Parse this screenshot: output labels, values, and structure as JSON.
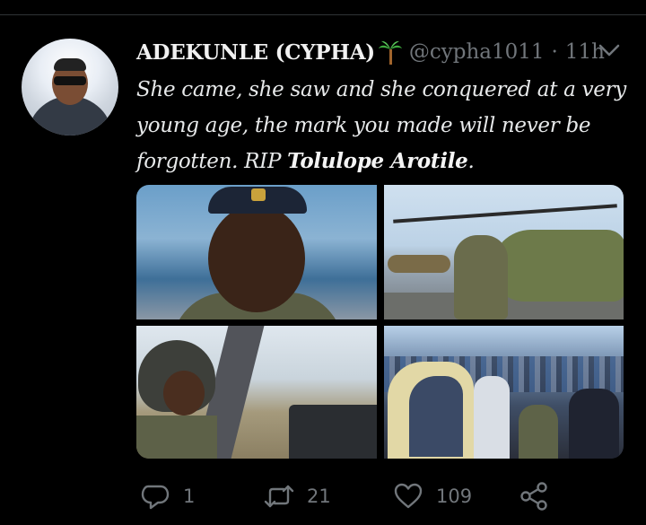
{
  "tweet": {
    "author_name": "ADEKUNLE (CYPHA)",
    "author_emoji": "palm-tree-icon",
    "handle": "@cypha1011",
    "separator": "·",
    "time": "11h",
    "text_before": "She came, she saw and she conquered at a very young age, the mark you made will never be forgotten. RIP ",
    "text_bold": "Tolulope Arotile",
    "text_after": ".",
    "media_count": 4
  },
  "actions": {
    "replies": "1",
    "retweets": "21",
    "likes": "109"
  },
  "colors": {
    "background": "#000000",
    "text": "#e7e9ea",
    "muted": "#71767b",
    "divider": "#2f3336"
  }
}
